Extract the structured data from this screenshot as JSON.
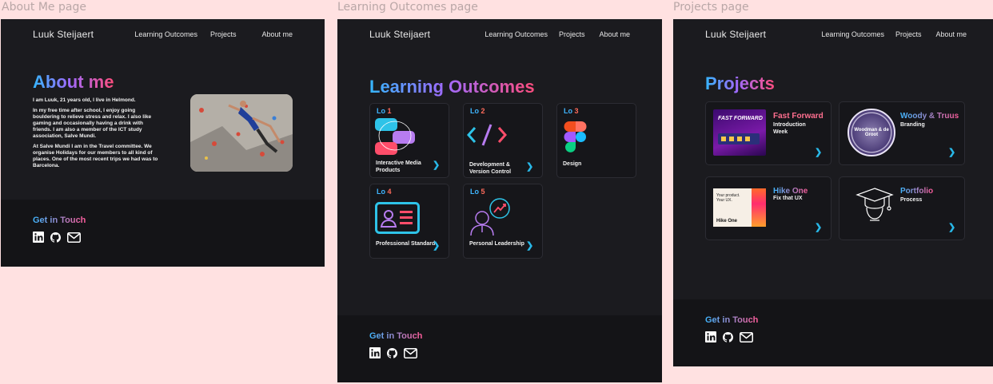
{
  "frames": {
    "about": {
      "label": "About Me page"
    },
    "learning": {
      "label": "Learning Outcomes page"
    },
    "projects": {
      "label": "Projects page"
    }
  },
  "nav": {
    "brand": "Luuk Steijaert",
    "links": [
      "Learning Outcomes",
      "Projects",
      "About me"
    ]
  },
  "about": {
    "title": "About me",
    "paragraphs": [
      "I am Luuk, 21 years old, I live in Helmond.",
      "In my free time after school, I enjoy going bouldering to relieve stress and relax. I also like gaming and occasionally having a drink with friends. I am also a member of the ICT study association, Salve Mundi.",
      "At Salve Mundi I am in the Travel committee. We organise Holidays for our members to all kind of places.  One of the most recent trips we had was to Barcelona."
    ]
  },
  "learning": {
    "title": "Learning Outcomes",
    "cards": [
      {
        "lo": "Lo",
        "num": "1",
        "title": "Interactive Media Products"
      },
      {
        "lo": "Lo",
        "num": "2",
        "title": "Development & Version Control"
      },
      {
        "lo": "Lo",
        "num": "3",
        "title": "Design"
      },
      {
        "lo": "Lo",
        "num": "4",
        "title": "Professional Standard"
      },
      {
        "lo": "Lo",
        "num": "5",
        "title": "Personal Leadership"
      }
    ]
  },
  "projects": {
    "title": "Projects",
    "cards": [
      {
        "title": "Fast Forward",
        "subtitle": "Introduction Week",
        "thumb_text": "FAST FORWARD"
      },
      {
        "title": "Woody & Truus",
        "subtitle": "Branding",
        "thumb_text": "Woodman & de Groot"
      },
      {
        "title": "Hike One",
        "subtitle": "Fix that UX",
        "thumb_text_1": "Your product. Your UX.",
        "thumb_text_2": "Hike One"
      },
      {
        "title": "Portfolio",
        "subtitle": "Process"
      }
    ]
  },
  "footer": {
    "title": "Get in Touch",
    "icons": [
      "linkedin-icon",
      "github-icon",
      "mail-icon"
    ]
  },
  "colors": {
    "accent_blue": "#35b6ff",
    "accent_purple": "#9d6bff",
    "accent_pink": "#ff4d7d",
    "arrow": "#28b8e8",
    "bg": "#1b1b1f"
  }
}
